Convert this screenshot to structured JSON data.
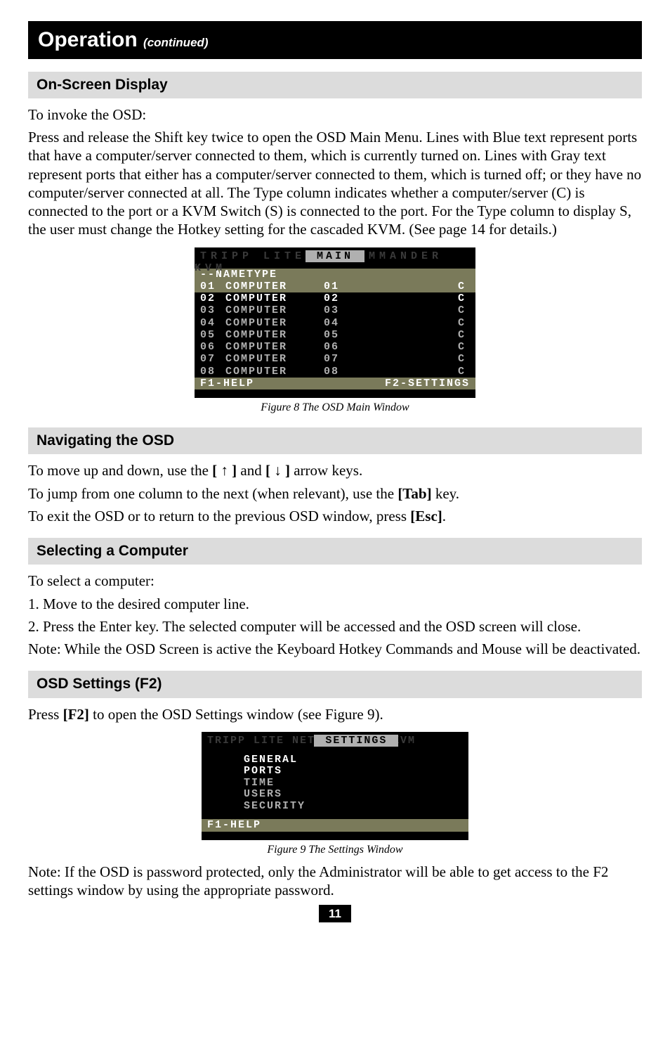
{
  "title": {
    "main": "Operation",
    "continued": "(continued)"
  },
  "sections": {
    "osd": {
      "heading": "On-Screen Display",
      "intro": "To invoke the OSD:",
      "para": "Press and release the Shift key twice to open the OSD Main Menu. Lines with Blue text represent ports that have a computer/server connected to them, which is currently turned on. Lines with Gray text represent ports that either has a computer/server connected to them, which is turned off; or they have no computer/server connected at all. The Type column indicates whether a computer/server (C) is connected to the port or a KVM Switch (S) is connected to the port. For the Type column to display S, the user must change the Hotkey setting for the cascaded KVM. (See page 14 for details.)",
      "caption": "Figure 8 The OSD Main Window"
    },
    "main_window": {
      "title_dim": "TRIPP LITE NETCOMMANDER KVM",
      "title_center": "MAIN",
      "header": {
        "dashes": "--",
        "name": "NAME",
        "type": "TYPE"
      },
      "rows": [
        {
          "num": "01",
          "name": "COMPUTER",
          "port": "01",
          "type": "C",
          "active": true
        },
        {
          "num": "02",
          "name": "COMPUTER",
          "port": "02",
          "type": "C",
          "active": true
        },
        {
          "num": "03",
          "name": "COMPUTER",
          "port": "03",
          "type": "C",
          "active": false
        },
        {
          "num": "04",
          "name": "COMPUTER",
          "port": "04",
          "type": "C",
          "active": false
        },
        {
          "num": "05",
          "name": "COMPUTER",
          "port": "05",
          "type": "C",
          "active": false
        },
        {
          "num": "06",
          "name": "COMPUTER",
          "port": "06",
          "type": "C",
          "active": false
        },
        {
          "num": "07",
          "name": "COMPUTER",
          "port": "07",
          "type": "C",
          "active": false
        },
        {
          "num": "08",
          "name": "COMPUTER",
          "port": "08",
          "type": "C",
          "active": false
        }
      ],
      "footer_left": "F1-HELP",
      "footer_right": "F2-SETTINGS"
    },
    "nav": {
      "heading": "Navigating the OSD",
      "line1_pre": "To move up and down, use the ",
      "key_up": "[ ↑ ]",
      "line1_mid": "  and ",
      "key_down": "[ ↓ ]",
      "line1_post": " arrow keys.",
      "line2_pre": "To jump from one column to the next (when relevant), use the ",
      "key_tab": "[Tab]",
      "line2_post": " key.",
      "line3_pre": "To exit the OSD or to return to the previous OSD window, press ",
      "key_esc": "[Esc]",
      "line3_post": "."
    },
    "select": {
      "heading": "Selecting a Computer",
      "intro": "To select a computer:",
      "step1": "1. Move to the desired computer line.",
      "step2": "2. Press the Enter key. The selected computer will be accessed and the OSD screen will close.",
      "note": "Note: While the OSD Screen is active the Keyboard Hotkey Commands and Mouse will be deactivated."
    },
    "settings": {
      "heading": "OSD Settings (F2)",
      "para_pre": "Press ",
      "key_f2": "[F2]",
      "para_post": " to open the OSD Settings window (see Figure 9).",
      "caption": "Figure 9 The Settings Window"
    },
    "settings_window": {
      "title_dim": "TRIPP LITE NETCOMMANDER KVM",
      "title_center": "SETTINGS",
      "items": [
        {
          "label": "GENERAL",
          "selected": true
        },
        {
          "label": "PORTS",
          "selected": true
        },
        {
          "label": "TIME",
          "selected": false
        },
        {
          "label": "USERS",
          "selected": false
        },
        {
          "label": "SECURITY",
          "selected": false
        }
      ],
      "footer_left": "F1-HELP"
    },
    "footer_note": "Note: If the OSD is password protected, only the Administrator will be able to get access to the F2 settings window by using the appropriate password."
  },
  "page_number": "11"
}
